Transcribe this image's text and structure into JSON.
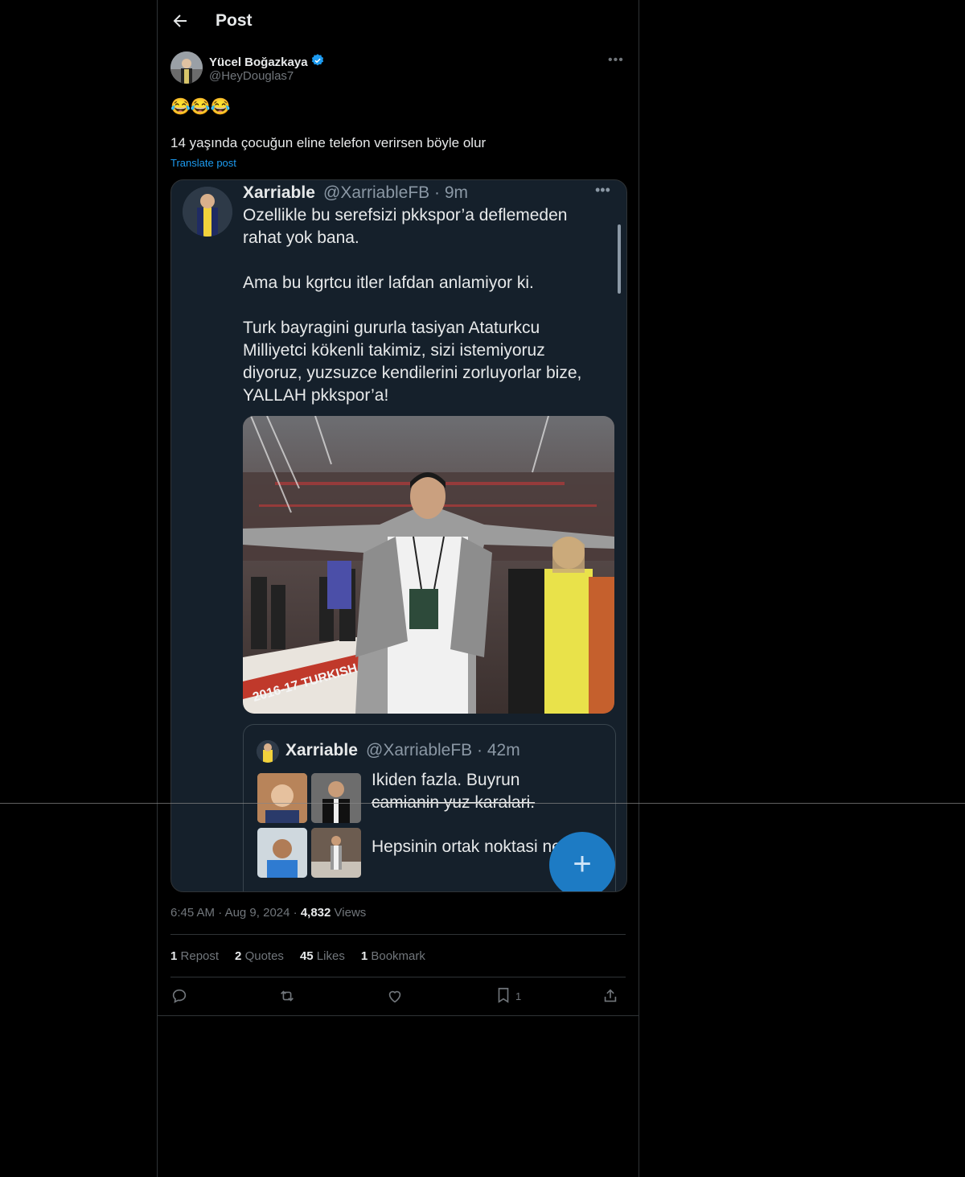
{
  "header": {
    "title": "Post"
  },
  "author": {
    "name": "Yücel Boğazkaya",
    "handle": "@HeyDouglas7"
  },
  "post": {
    "emoji": "😂😂😂",
    "text": "14 yaşında çocuğun eline telefon verirsen böyle olur",
    "translate": "Translate post"
  },
  "screenshot": {
    "name": "Xarriable",
    "handle": "@XarriableFB · 9m",
    "body": "Ozellikle bu serefsizi pkkspor’a deflemeden\nrahat yok bana.\n\nAma bu kgrtcu itler lafdan anlamiyor ki.\n\nTurk bayragini gururla tasiyan Ataturkcu\nMilliyetci kökenli takimiz, sizi istemiyoruz\ndiyoruz, yuzsuzce kendilerini zorluyorlar bize,\nYALLAH pkkspor’a!",
    "photo_caption": "2016-17 TURKISH AIRLINES",
    "quote": {
      "name": "Xarriable",
      "handle": "@XarriableFB · 42m",
      "text1": "Ikiden fazla. Buyrun\ncamianin yuz karalari.",
      "text2": "Hepsinin ortak noktasi ne? ..."
    }
  },
  "meta": {
    "time": "6:45 AM",
    "date": "Aug 9, 2024",
    "views_count": "4,832",
    "views_label": "Views"
  },
  "stats": [
    {
      "count": "1",
      "label": "Repost"
    },
    {
      "count": "2",
      "label": "Quotes"
    },
    {
      "count": "45",
      "label": "Likes"
    },
    {
      "count": "1",
      "label": "Bookmark"
    }
  ],
  "actions": {
    "bookmark_count": "1"
  },
  "colors": {
    "background": "#000000",
    "accent": "#1d9bf0",
    "muted": "#71767b",
    "card": "#15202b"
  }
}
